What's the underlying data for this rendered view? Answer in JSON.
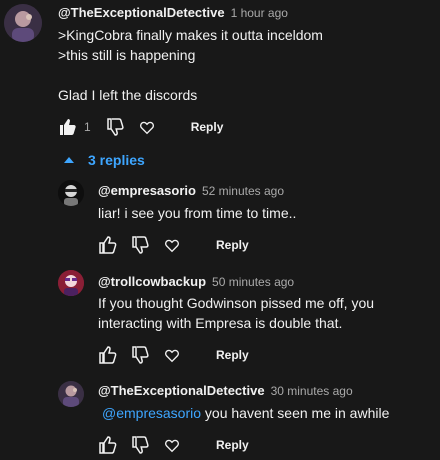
{
  "comment": {
    "handle": "@TheExceptionalDetective",
    "time": "1 hour ago",
    "lines": [
      ">KingCobra finally makes it outta inceldom",
      ">this still is happening",
      "",
      "Glad I left the discords"
    ],
    "likes": "1",
    "reply_label": "Reply"
  },
  "replies_toggle": {
    "label": "3 replies"
  },
  "replies": [
    {
      "handle": "@empresasorio",
      "time": "52 minutes ago",
      "lines": [
        "liar! i see you from time to time.."
      ],
      "reply_label": "Reply"
    },
    {
      "handle": "@trollcowbackup",
      "time": "50 minutes ago",
      "lines": [
        "If you thought Godwinson pissed me off, you",
        "interacting with Empresa is double that."
      ],
      "reply_label": "Reply"
    },
    {
      "handle": "@TheExceptionalDetective",
      "time": "30 minutes ago",
      "mention": "@empresasorio",
      "text": " you havent seen me in awhile",
      "reply_label": "Reply"
    }
  ],
  "icons": {
    "like": "thumbs-up-icon",
    "dislike": "thumbs-down-icon",
    "heart": "heart-icon",
    "expand": "triangle-up-icon"
  },
  "colors": {
    "background": "#181818",
    "text": "#f1f1f1",
    "secondary": "#aaaaaa",
    "link": "#3ea6ff"
  }
}
